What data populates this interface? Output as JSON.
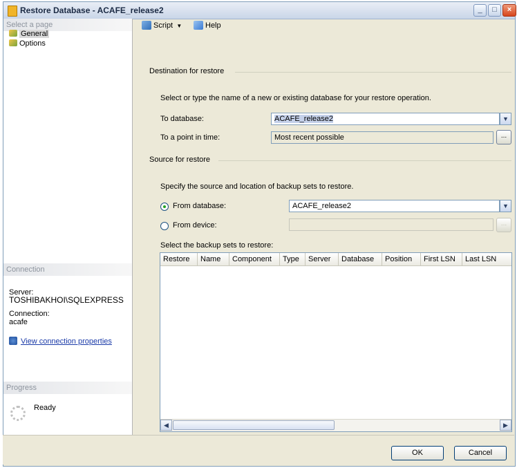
{
  "window": {
    "title": "Restore Database - ACAFE_release2"
  },
  "left": {
    "select_page_header": "Select a page",
    "pages": [
      {
        "label": "General"
      },
      {
        "label": "Options"
      }
    ],
    "connection_header": "Connection",
    "server_label": "Server:",
    "server_value": "TOSHIBAKHOI\\SQLEXPRESS",
    "connection_label": "Connection:",
    "connection_value": "acafe",
    "view_connection_link": "View connection properties",
    "progress_header": "Progress",
    "progress_status": "Ready"
  },
  "toolbar": {
    "script_label": "Script",
    "help_label": "Help"
  },
  "destination": {
    "header": "Destination for restore",
    "instructions": "Select or type the name of a new or existing database for your restore operation.",
    "to_database_label": "To database:",
    "to_database_value": "ACAFE_release2",
    "point_in_time_label": "To a point in time:",
    "point_in_time_value": "Most recent possible"
  },
  "source": {
    "header": "Source for restore",
    "instructions": "Specify the source and location of backup sets to restore.",
    "from_database_label": "From database:",
    "from_database_value": "ACAFE_release2",
    "from_device_label": "From device:",
    "from_device_value": "",
    "selected_option": "From database"
  },
  "backup_sets": {
    "label": "Select the backup sets to restore:",
    "columns": [
      "Restore",
      "Name",
      "Component",
      "Type",
      "Server",
      "Database",
      "Position",
      "First LSN",
      "Last LSN"
    ],
    "rows": []
  },
  "buttons": {
    "ok": "OK",
    "cancel": "Cancel"
  }
}
